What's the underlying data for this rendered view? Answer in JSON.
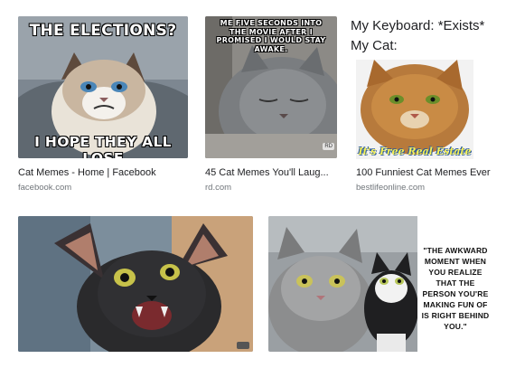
{
  "results": [
    {
      "meme_top": "THE ELECTIONS?",
      "meme_bottom": "I HOPE THEY ALL LOSE",
      "title": "Cat Memes - Home | Facebook",
      "source": "facebook.com"
    },
    {
      "meme_top": "ME FIVE SECONDS INTO THE MOVIE AFTER I PROMISED I WOULD STAY AWAKE.",
      "watermark": "RD",
      "title": "45 Cat Memes You'll Laug...",
      "source": "rd.com"
    },
    {
      "meme_line1": "My Keyboard: *Exists*",
      "meme_line2": "My Cat:",
      "meme_bottom": "It's Free Real Estate",
      "title": "100 Funniest Cat Memes Ever",
      "source": "bestlifeonline.com"
    },
    {
      "title": "",
      "source": ""
    },
    {
      "meme_text": "\"THE AWKWARD MOMENT WHEN YOU REALIZE THAT THE PERSON YOU'RE MAKING FUN OF IS RIGHT BEHIND YOU.\"",
      "title": "",
      "source": ""
    }
  ]
}
